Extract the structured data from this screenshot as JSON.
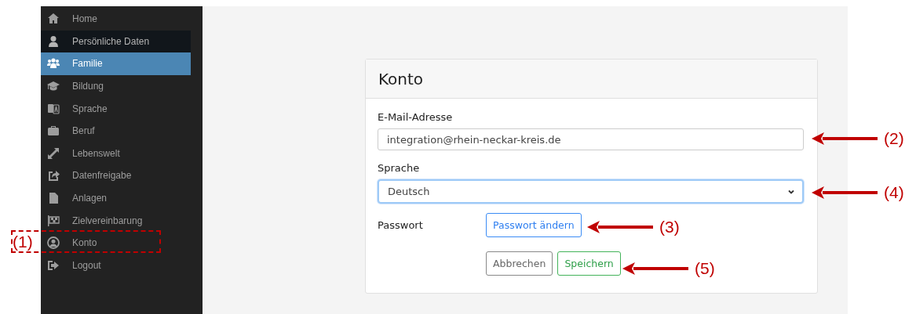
{
  "sidebar": {
    "items": [
      {
        "label": "Home",
        "selected": false,
        "hovered": false
      },
      {
        "label": "Persönliche Daten",
        "selected": false,
        "hovered": true
      },
      {
        "label": "Familie",
        "selected": true,
        "hovered": false
      },
      {
        "label": "Bildung",
        "selected": false,
        "hovered": false
      },
      {
        "label": "Sprache",
        "selected": false,
        "hovered": false
      },
      {
        "label": "Beruf",
        "selected": false,
        "hovered": false
      },
      {
        "label": "Lebenswelt",
        "selected": false,
        "hovered": false
      },
      {
        "label": "Datenfreigabe",
        "selected": false,
        "hovered": false
      },
      {
        "label": "Anlagen",
        "selected": false,
        "hovered": false
      },
      {
        "label": "Zielvereinbarung",
        "selected": false,
        "hovered": false
      },
      {
        "label": "Konto",
        "selected": false,
        "hovered": false
      },
      {
        "label": "Logout",
        "selected": false,
        "hovered": false
      }
    ]
  },
  "card": {
    "title": "Konto",
    "email": {
      "label": "E-Mail-Adresse",
      "value": "integration@rhein-neckar-kreis.de"
    },
    "language": {
      "label": "Sprache",
      "value": "Deutsch",
      "focused": true
    },
    "password": {
      "label": "Passwort",
      "button": "Passwort ändern"
    },
    "buttons": [
      {
        "label": "Abbrechen",
        "kind": "secondary"
      },
      {
        "label": "Speichern",
        "kind": "success"
      }
    ]
  },
  "annotations": [
    {
      "label": "(1)",
      "kind": "frame"
    },
    {
      "label": "(2)",
      "kind": "arrow"
    },
    {
      "label": "(3)",
      "kind": "arrow"
    },
    {
      "label": "(4)",
      "kind": "arrow"
    },
    {
      "label": "(5)",
      "kind": "arrow"
    }
  ]
}
